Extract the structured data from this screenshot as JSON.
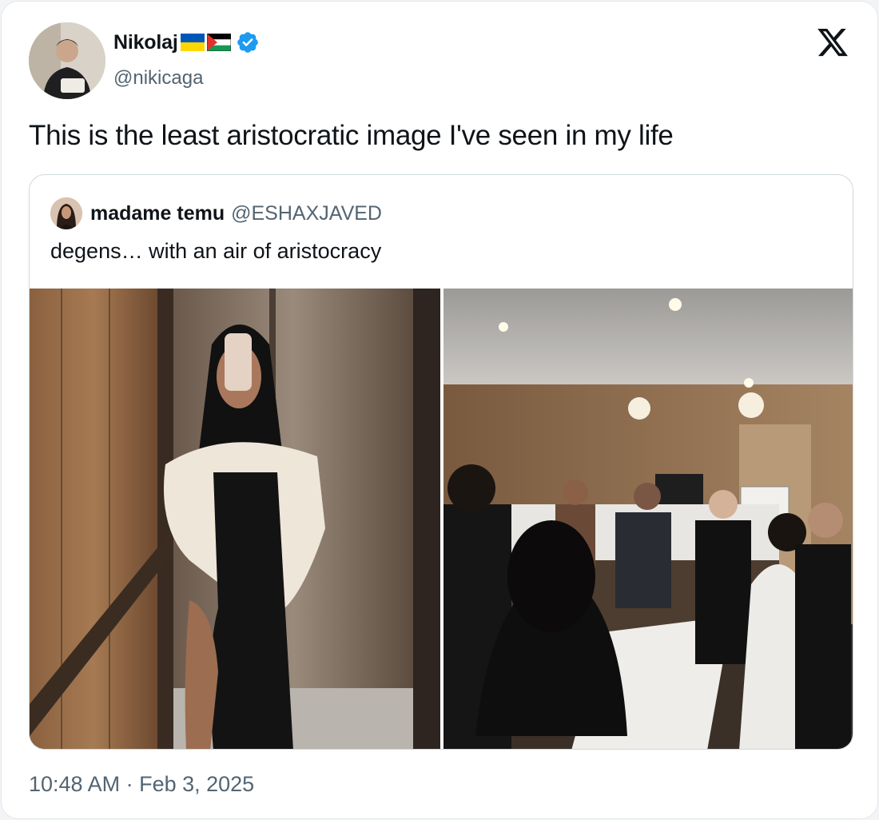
{
  "author": {
    "display_name": "Nikolaj",
    "handle": "@nikicaga",
    "flags": [
      "ukraine-flag-icon",
      "palestine-flag-icon"
    ],
    "verified": true
  },
  "tweet": {
    "text": "This is the least aristocratic image I've seen in my life",
    "timestamp": "10:48 AM · Feb 3, 2025"
  },
  "quoted": {
    "display_name": "madame temu",
    "handle": "@ESHAXJAVED",
    "text": "degens… with an air of aristocracy",
    "images": [
      "elevator-mirror-selfie-image",
      "kitchen-party-image"
    ]
  },
  "colors": {
    "verified_blue": "#1d9bf0",
    "secondary_text": "#536471",
    "border": "#cfd9de"
  }
}
